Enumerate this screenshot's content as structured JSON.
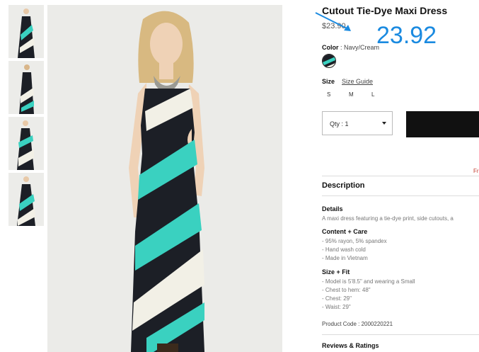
{
  "product": {
    "title": "Cutout Tie-Dye Maxi Dress",
    "price": "$23.90",
    "price_overlay": "23.92"
  },
  "color": {
    "label": "Color",
    "separator": ":",
    "value": "Navy/Cream",
    "swatch_colors": [
      "#1c1f26",
      "#3ad1c0",
      "#f2f0e6"
    ]
  },
  "size": {
    "label": "Size",
    "guide": "Size Guide",
    "options": [
      "S",
      "M",
      "L"
    ]
  },
  "quantity": {
    "label": "Qty : 1"
  },
  "fr_text": "Fr",
  "description": {
    "heading": "Description",
    "details_heading": "Details",
    "details_text": "A maxi dress featuring a tie-dye print, side cutouts, a",
    "content_heading": "Content + Care",
    "content_lines": [
      "- 95% rayon, 5% spandex",
      "- Hand wash cold",
      "- Made in Vietnam"
    ],
    "fit_heading": "Size + Fit",
    "fit_lines": [
      "- Model is 5'8.5\" and wearing a Small",
      "- Chest to hem: 48\"",
      "- Chest: 29\"",
      "- Waist: 29\""
    ],
    "product_code": "Product Code : 2000220221"
  },
  "reviews": {
    "heading": "Reviews & Ratings"
  },
  "colors": {
    "navy": "#1c1f26",
    "teal": "#3ad1c0",
    "cream": "#f2f0e6",
    "accent": "#1a8ae0"
  }
}
